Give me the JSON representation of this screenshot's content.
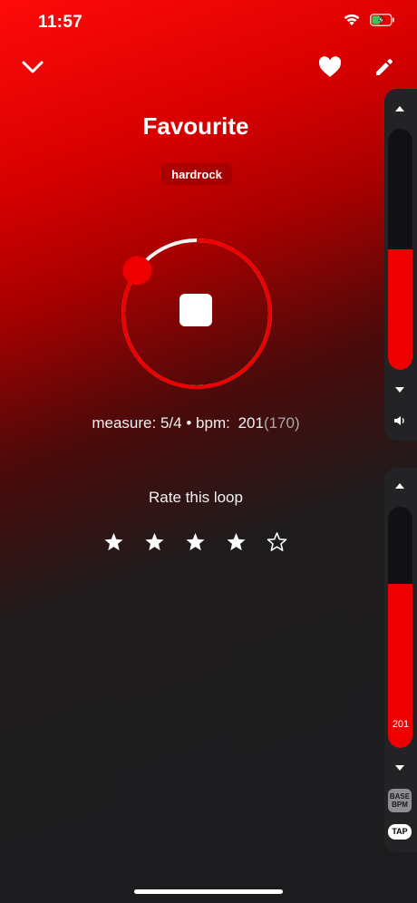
{
  "status_bar": {
    "time": "11:57",
    "icons": [
      "wifi-icon",
      "battery-charging-icon"
    ]
  },
  "nav": {
    "left_icon": "chevron-down-icon",
    "right_icons": [
      "heart-icon",
      "pencil-icon"
    ]
  },
  "loop": {
    "title": "Favourite",
    "tag": "hardrock",
    "playback_state": "playing",
    "progress_fraction": 0.85
  },
  "info": {
    "measure_label": "measure:",
    "measure_value": "5/4",
    "separator": "•",
    "bpm_label": "bpm:",
    "bpm_value": "201",
    "base_bpm": "(170)"
  },
  "rating": {
    "title": "Rate this loop",
    "value": 4,
    "max": 5
  },
  "volume_panel": {
    "icon": "speaker-icon",
    "level_fraction": 0.5
  },
  "bpm_panel": {
    "value_label": "201",
    "level_fraction": 0.68,
    "base_bpm_button": "BASE BPM",
    "tap_button": "TAP"
  },
  "colors": {
    "accent": "#ee0000",
    "background": "#1c1c1e",
    "panel": "#232325"
  }
}
